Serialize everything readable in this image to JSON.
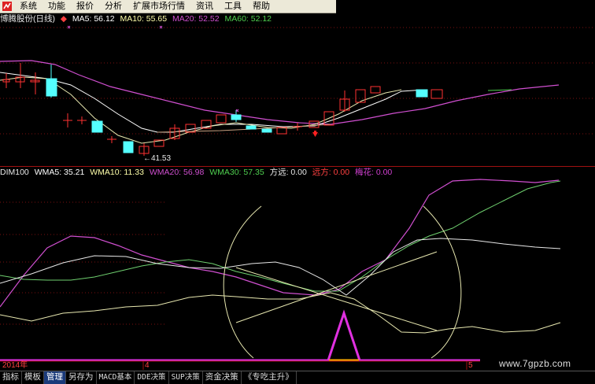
{
  "menu": {
    "items": [
      "系统",
      "功能",
      "报价",
      "分析",
      "扩展市场行情",
      "资讯",
      "工具",
      "帮助"
    ]
  },
  "main_chart": {
    "stock_name": "博腾股份(日线)",
    "ma5_label": "MA5: 56.12",
    "ma10_label": "MA10: 55.65",
    "ma20_label": "MA20: 52.52",
    "ma60_label": "MA60: 52.12",
    "low_marker": "←41.53"
  },
  "indicator": {
    "name": "DIM100",
    "wma5": "WMA5: 35.21",
    "wma10": "WMA10: 11.33",
    "wma20": "WMA20: 56.98",
    "wma30": "WMA30: 57.35",
    "fangyuan": "方远: 0.00",
    "yuanfang": "远方: 0.00",
    "meihua": "梅花: 0.00"
  },
  "date_axis": {
    "labels": [
      "2014年",
      "4",
      "5"
    ]
  },
  "tabs": [
    "指标",
    "模板",
    "管理",
    "另存为",
    "MACD基本",
    "DDE决策",
    "SUP决策",
    "资金决策",
    "《专吃主升》"
  ],
  "active_tab": "管理",
  "watermark": "www.7gpzb.com",
  "colors": {
    "up_candle": "#ff3232",
    "down_candle": "#54ffff",
    "ma20": "#d04fd0",
    "ma60": "#4fd04f",
    "background": "#000000"
  }
}
